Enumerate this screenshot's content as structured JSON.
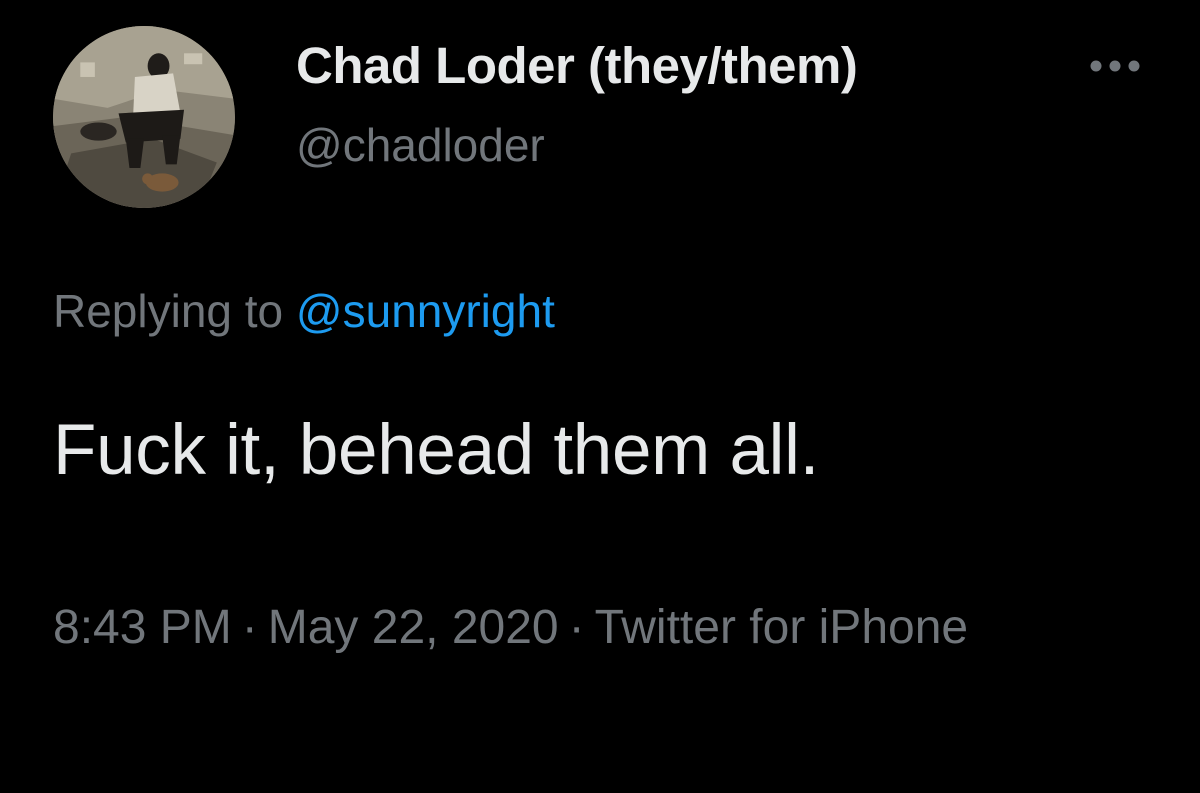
{
  "tweet": {
    "author": {
      "display_name": "Chad Loder (they/them)",
      "handle": "@chadloder"
    },
    "reply": {
      "prefix": "Replying to",
      "handle": "@sunnyright"
    },
    "text": "Fuck it, behead them all.",
    "meta": {
      "time": "8:43 PM",
      "separator": "·",
      "date": "May 22, 2020",
      "source": "Twitter for iPhone"
    }
  },
  "icons": {
    "more": "more-horizontal-icon",
    "avatar": "avatar-photo"
  },
  "colors": {
    "background": "#000000",
    "primary_text": "#e7e9ea",
    "secondary_text": "#71767b",
    "link": "#1d9bf0"
  }
}
